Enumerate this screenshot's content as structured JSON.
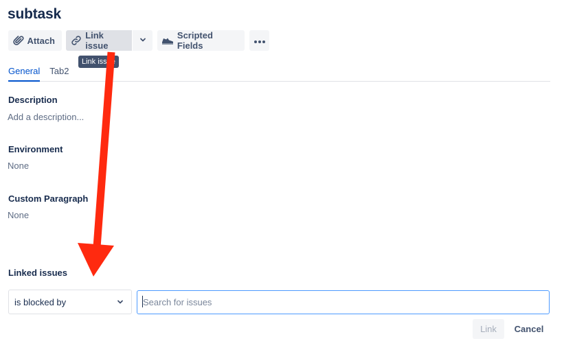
{
  "issue": {
    "title": "subtask"
  },
  "toolbar": {
    "attach_label": "Attach",
    "link_issue_label": "Link issue",
    "scripted_fields_label": "Scripted Fields",
    "tooltip": "Link issue"
  },
  "tabs": [
    {
      "label": "General",
      "active": true
    },
    {
      "label": "Tab2",
      "active": false
    }
  ],
  "fields": {
    "description": {
      "label": "Description",
      "value": "Add a description..."
    },
    "environment": {
      "label": "Environment",
      "value": "None"
    },
    "custom_paragraph": {
      "label": "Custom Paragraph",
      "value": "None"
    }
  },
  "linked_issues": {
    "label": "Linked issues",
    "relation": "is blocked by",
    "search_placeholder": "Search for issues",
    "link_label": "Link",
    "cancel_label": "Cancel"
  },
  "icons": {
    "attach": "paperclip-icon",
    "link": "link-icon",
    "dropdown": "chevron-down-icon",
    "scripted": "shoe-icon",
    "more": "more-icon"
  },
  "colors": {
    "accent": "#0052cc",
    "annotation_arrow": "#ff2a0f",
    "focus_border": "#4c9aff"
  }
}
